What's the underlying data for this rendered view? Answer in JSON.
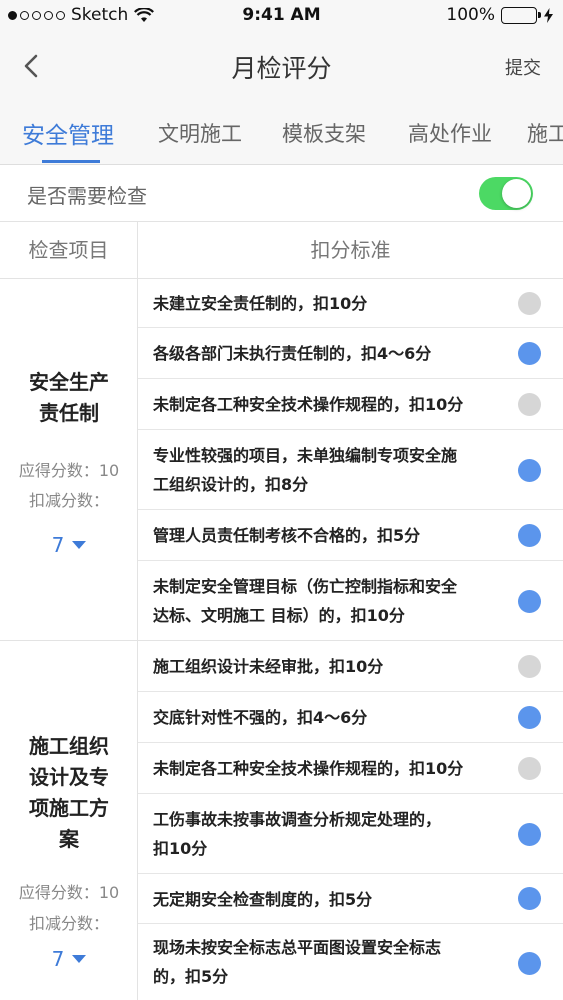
{
  "status_bar": {
    "carrier": "Sketch",
    "time": "9:41 AM",
    "battery": "100%"
  },
  "nav": {
    "title": "月检评分",
    "submit_label": "提交"
  },
  "tabs": [
    {
      "label": "安全管理",
      "active": true
    },
    {
      "label": "文明施工",
      "active": false
    },
    {
      "label": "模板支架",
      "active": false
    },
    {
      "label": "高处作业",
      "active": false
    },
    {
      "label": "施工",
      "active": false
    }
  ],
  "inspection_toggle": {
    "label": "是否需要检查",
    "on": true
  },
  "table_header": {
    "item": "检查项目",
    "criteria": "扣分标准"
  },
  "groups": [
    {
      "name_lines": [
        "安全生产",
        "责任制"
      ],
      "score_label": "应得分数：10",
      "deduct_label": "扣减分数：",
      "deduct_value": "7",
      "items": [
        {
          "lines": [
            "未建立安全责任制的，扣10分"
          ],
          "checked": false
        },
        {
          "lines": [
            "各级各部门未执行责任制的，扣4～6分"
          ],
          "checked": true
        },
        {
          "lines": [
            "未制定各工种安全技术操作规程的，扣10分"
          ],
          "checked": false
        },
        {
          "lines": [
            "专业性较强的项目，未单独编制专项安全施",
            "工组织设计的，扣8分"
          ],
          "checked": true
        },
        {
          "lines": [
            "管理人员责任制考核不合格的，扣5分"
          ],
          "checked": true
        },
        {
          "lines": [
            " 未制定安全管理目标（伤亡控制指标和安全",
            "达标、文明施工 目标）的，扣10分"
          ],
          "checked": true
        }
      ]
    },
    {
      "name_lines": [
        "施工组织",
        "设计及专",
        "项施工方",
        "案"
      ],
      "score_label": "应得分数：10",
      "deduct_label": "扣减分数：",
      "deduct_value": "7",
      "items": [
        {
          "lines": [
            "施工组织设计未经审批，扣10分"
          ],
          "checked": false
        },
        {
          "lines": [
            "交底针对性不强的，扣4～6分"
          ],
          "checked": true
        },
        {
          "lines": [
            "未制定各工种安全技术操作规程的，扣10分"
          ],
          "checked": false
        },
        {
          "lines": [
            "工伤事故未按事故调查分析规定处理的，",
            "扣10分"
          ],
          "checked": true
        },
        {
          "lines": [
            " 无定期安全检查制度的，扣5分"
          ],
          "checked": true
        },
        {
          "lines": [
            "现场未按安全标志总平面图设置安全标志",
            "的，扣5分"
          ],
          "checked": true
        }
      ]
    }
  ]
}
